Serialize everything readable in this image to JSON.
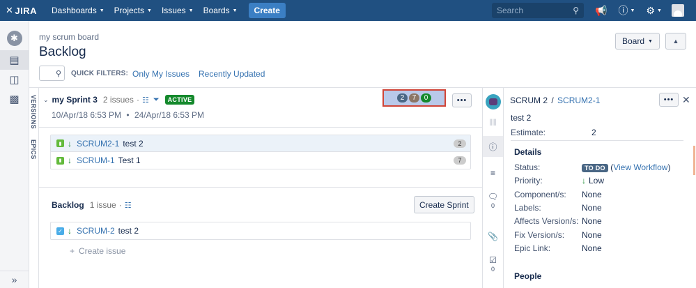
{
  "nav": {
    "logo": "JIRA",
    "items": [
      "Dashboards",
      "Projects",
      "Issues",
      "Boards"
    ],
    "create": "Create",
    "search_placeholder": "Search"
  },
  "header": {
    "breadcrumb": "my scrum board",
    "title": "Backlog",
    "board_button": "Board",
    "quick_filters_label": "QUICK FILTERS:",
    "filter_only_my_issues": "Only My Issues",
    "filter_recently_updated": "Recently Updated"
  },
  "side_tabs": [
    "VERSIONS",
    "EPICS"
  ],
  "sprint": {
    "name": "my Sprint 3",
    "issue_count": "2 issues",
    "separator": "·",
    "status": "ACTIVE",
    "dates_start": "10/Apr/18 6:53 PM",
    "dates_sep": "•",
    "dates_end": "24/Apr/18 6:53 PM",
    "points": {
      "todo": "2",
      "in_progress": "7",
      "done": "0"
    },
    "issues": [
      {
        "key": "SCRUM2-1",
        "summary": "test 2",
        "estimate": "2"
      },
      {
        "key": "SCRUM-1",
        "summary": "Test 1",
        "estimate": "7"
      }
    ]
  },
  "backlog": {
    "name": "Backlog",
    "issue_count": "1 issue",
    "separator": "·",
    "create_sprint": "Create Sprint",
    "issues": [
      {
        "key": "SCRUM-2",
        "summary": "test 2"
      }
    ],
    "create_issue": "Create issue"
  },
  "detail": {
    "project": "SCRUM 2",
    "separator": "/",
    "key": "SCRUM2-1",
    "summary": "test 2",
    "estimate_label": "Estimate:",
    "estimate_value": "2",
    "details_title": "Details",
    "status_label": "Status:",
    "status_value": "TO DO",
    "workflow_open": "(",
    "workflow_link": "View Workflow",
    "workflow_close": ")",
    "priority_label": "Priority:",
    "priority_value": "Low",
    "components_label": "Component/s:",
    "components_value": "None",
    "labels_label": "Labels:",
    "labels_value": "None",
    "affects_label": "Affects Version/s:",
    "affects_value": "None",
    "fix_label": "Fix Version/s:",
    "fix_value": "None",
    "epic_label": "Epic Link:",
    "epic_value": "None",
    "people_title": "People",
    "comment_count": "0",
    "subtask_count": "0"
  },
  "colors": {
    "nav_bg": "#205081",
    "active_lozenge": "#14892c",
    "link": "#3572b0",
    "highlight_border": "#d04437"
  }
}
